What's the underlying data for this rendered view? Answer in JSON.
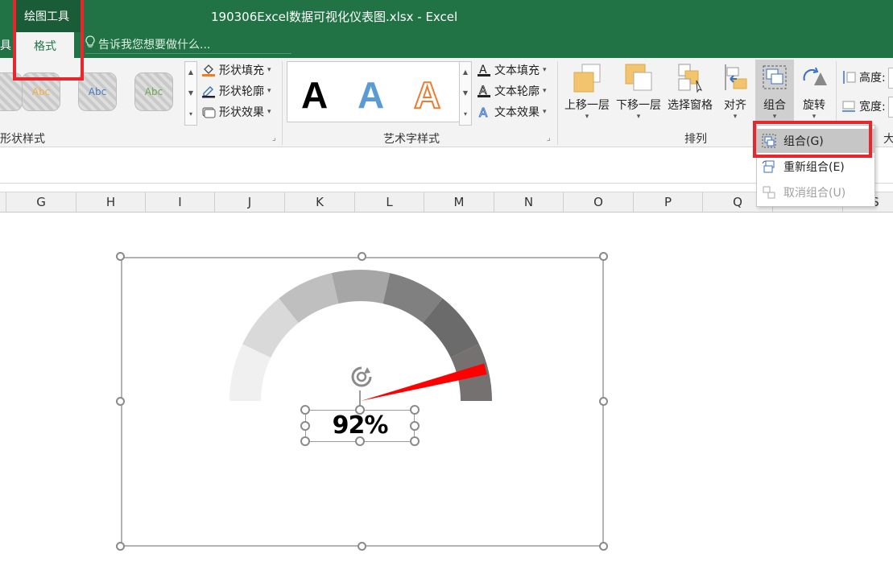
{
  "title_bar": {
    "context_tab_group": "绘图工具",
    "window_title": "190306Excel数据可视化仪表图.xlsx - Excel"
  },
  "tabs": {
    "left_cut": "具",
    "format": "格式",
    "tell_me": "告诉我您想要做什么..."
  },
  "ribbon": {
    "shape_styles": {
      "thumb_label": "Abc",
      "fill": "形状填充",
      "outline": "形状轮廓",
      "effects": "形状效果",
      "group_label": "形状样式"
    },
    "wordart_styles": {
      "letter": "A",
      "fill": "文本填充",
      "outline": "文本轮廓",
      "effects": "文本效果",
      "group_label": "艺术字样式"
    },
    "arrange": {
      "bring_forward": "上移一层",
      "send_backward": "下移一层",
      "selection_pane": "选择窗格",
      "align": "对齐",
      "group": "组合",
      "rotate": "旋转",
      "group_label": "排列"
    },
    "size": {
      "height": "高度:",
      "width": "宽度:",
      "group_label_cut": "大"
    }
  },
  "columns": [
    "G",
    "H",
    "I",
    "J",
    "K",
    "L",
    "M",
    "N",
    "O",
    "P",
    "Q",
    "R",
    "S"
  ],
  "group_menu": {
    "items": [
      {
        "label": "组合(G)",
        "state": "highlighted"
      },
      {
        "label": "重新组合(E)",
        "state": "enabled"
      },
      {
        "label": "取消组合(U)",
        "state": "disabled"
      }
    ]
  },
  "gauge": {
    "value_text": "92%",
    "value_fraction": 0.92,
    "segment_colors": [
      "#f0f0f0",
      "#d9d9d9",
      "#bfbfbf",
      "#a6a6a6",
      "#808080",
      "#6b6b6b",
      "#767171"
    ],
    "needle_color": "#ff0000"
  },
  "colors": {
    "excel_green": "#217346",
    "highlight_red": "#e8262b"
  }
}
